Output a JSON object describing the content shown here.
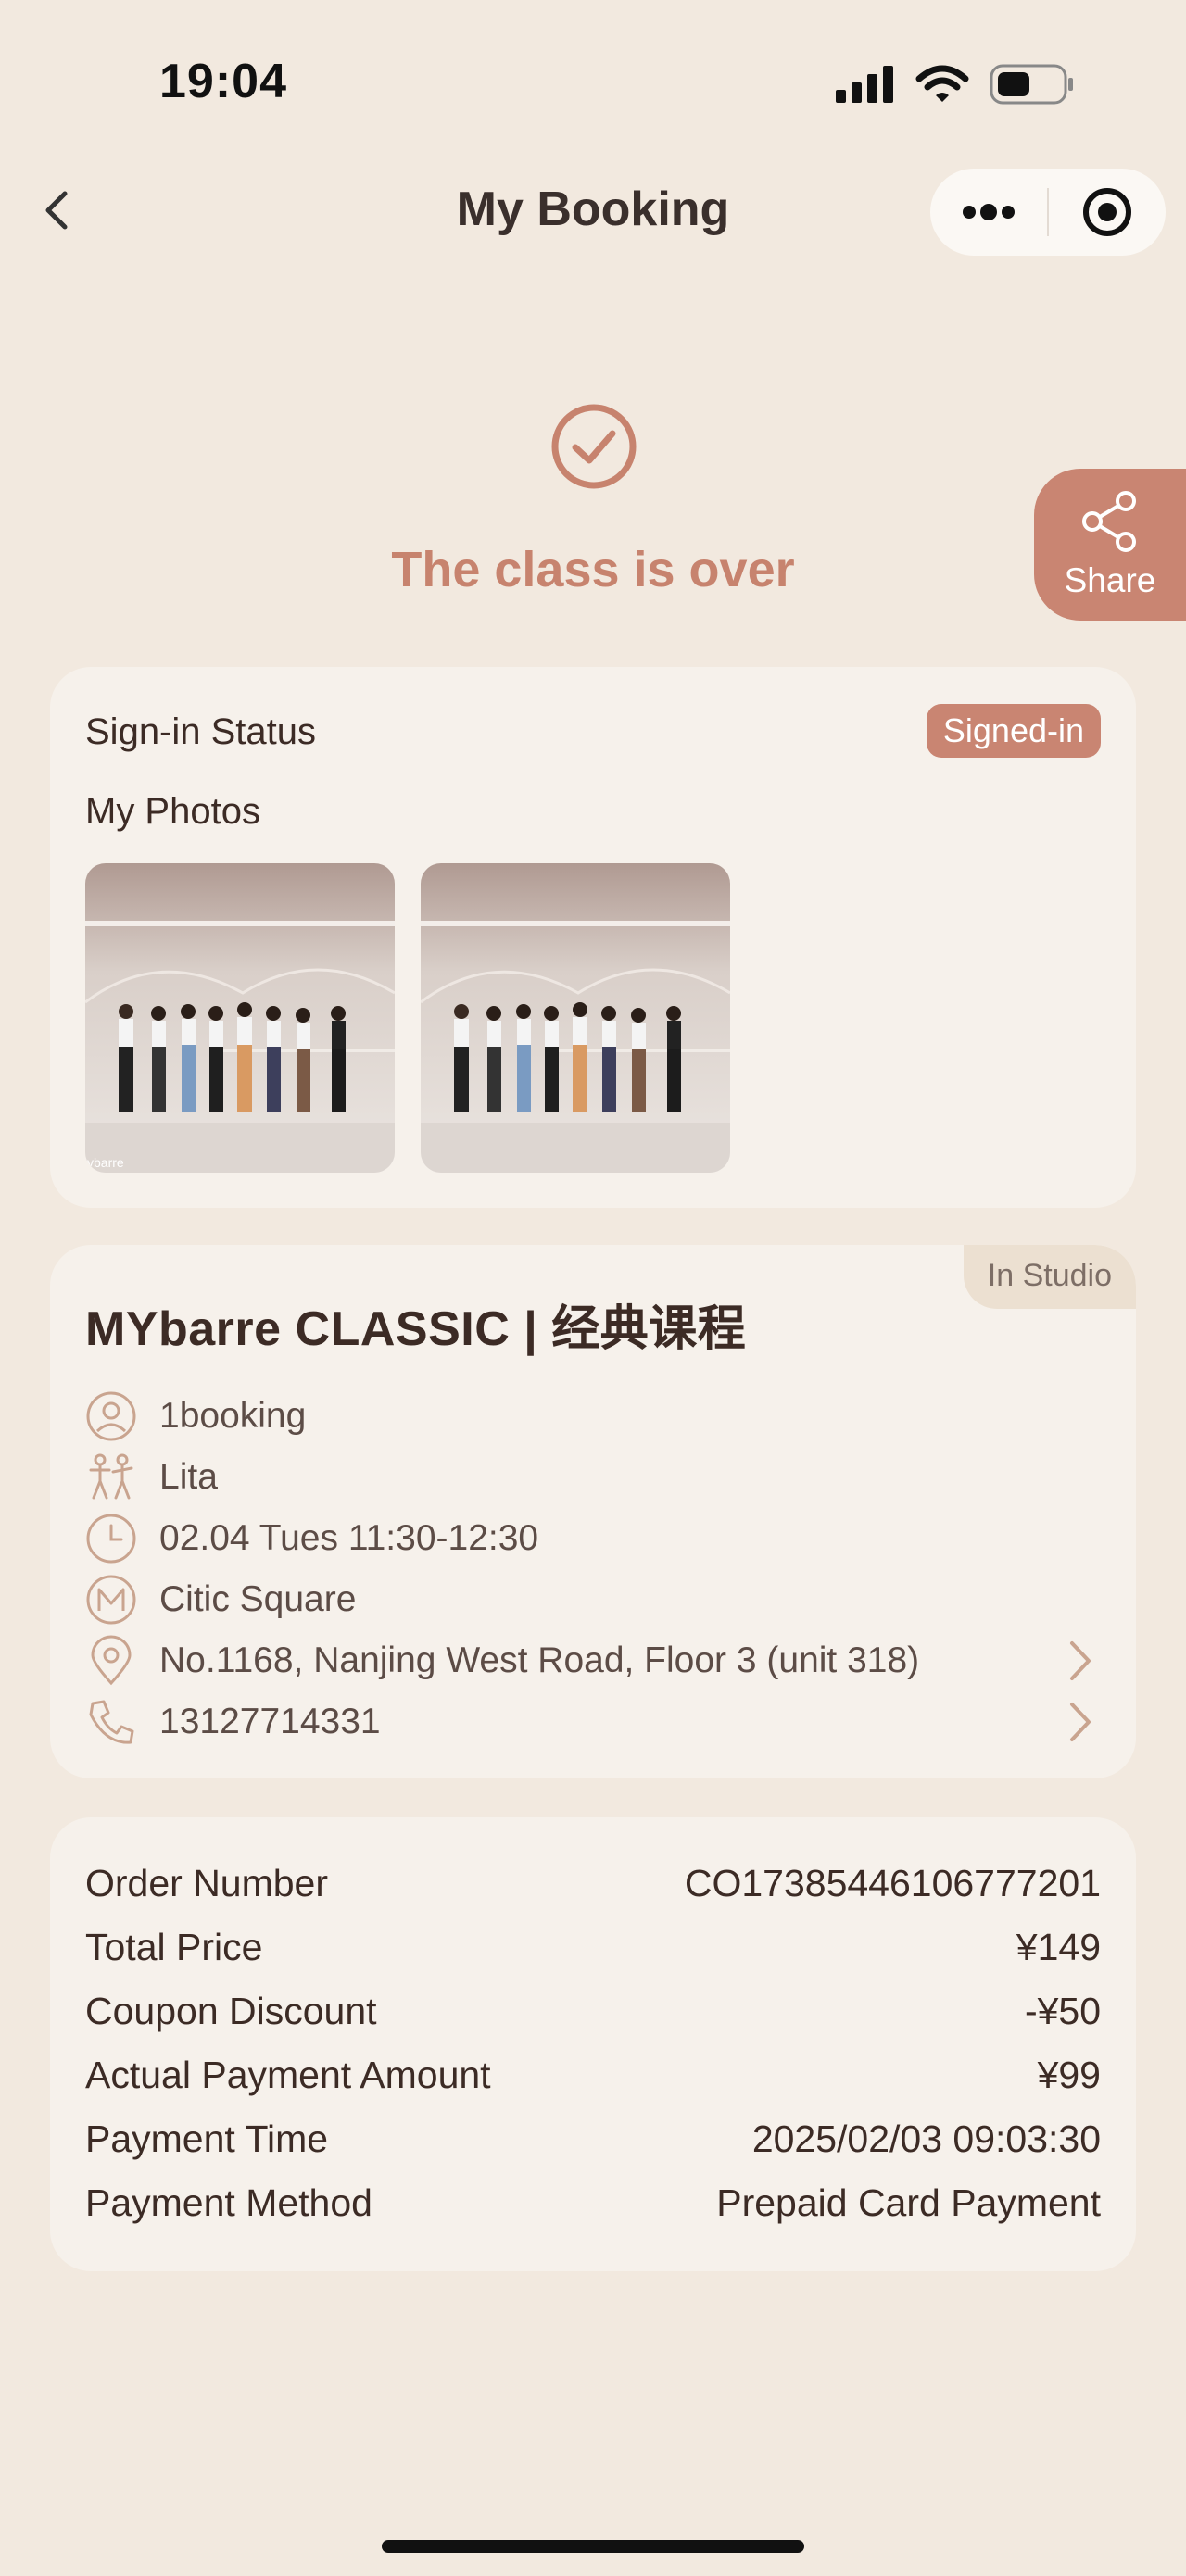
{
  "status_bar": {
    "time": "19:04"
  },
  "nav": {
    "title": "My Booking"
  },
  "status": {
    "text": "The class is over"
  },
  "share": {
    "label": "Share"
  },
  "signin": {
    "label": "Sign-in Status",
    "badge": "Signed-in",
    "photos_label": "My Photos",
    "photo_watermark": "ybarre"
  },
  "class": {
    "mode_tag": "In Studio",
    "title": "MYbarre CLASSIC | 经典课程",
    "booking_source": "1booking",
    "instructor": "Lita",
    "datetime": "02.04 Tues 11:30-12:30",
    "studio": "Citic Square",
    "address": "No.1168, Nanjing West Road, Floor 3 (unit 318)",
    "phone": "13127714331"
  },
  "order": {
    "rows": [
      {
        "label": "Order Number",
        "value": "CO17385446106777201"
      },
      {
        "label": "Total Price",
        "value": "¥149"
      },
      {
        "label": "Coupon Discount",
        "value": "-¥50"
      },
      {
        "label": "Actual Payment Amount",
        "value": "¥99"
      },
      {
        "label": "Payment Time",
        "value": "2025/02/03 09:03:30"
      },
      {
        "label": "Payment Method",
        "value": "Prepaid Card Payment"
      }
    ]
  },
  "colors": {
    "accent": "#c98572",
    "background": "#f2e9df",
    "card": "#f6f1eb",
    "icon": "#c9a48f"
  }
}
